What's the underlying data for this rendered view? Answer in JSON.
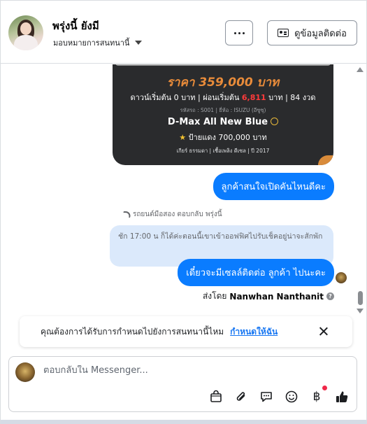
{
  "header": {
    "contact_name": "พรุ่งนี้ ยังมี",
    "assign_label": "มอบหมายการสนทนานี้",
    "more_label": "...",
    "info_button_label": "ดูข้อมูลติดต่อ"
  },
  "chat": {
    "card": {
      "price": "ราคา 359,000 บาท",
      "terms_prefix": "ดาวน์เริ่มต้น 0 บาท | ผ่อนเริ่มต้น ",
      "terms_installment": "6,811",
      "terms_suffix": " บาท | 84 งวด",
      "meta": "รหัสรถ : S001 | ยี่ห้อ : ISUZU (อีซูซุ)",
      "model": "D-Max All New Blue",
      "plate": "ป้ายแดง 700,000 บาท",
      "specs": "เกียร์ ธรรมดา  |  เชื้อเพลิง ดีเซล  |  ปี 2017"
    },
    "msg_customer_question": "ลูกค้าสนใจเปิดคันไหนดีคะ",
    "reply_note": "รถยนต์มือสอง ตอบกลับ พรุ่งนี้",
    "quoted_text": "ชัก 17:00 น ก็ได้ค่ะตอนนี้เขาเข้าออฟฟิศไปรับเช็คอยู่น่าจะสักพัก",
    "msg_reply": "เดี๋ยวจะมีเซลล์ติดต่อ ลูกค้า ไปนะคะ",
    "sent_by_label": "ส่งโดย",
    "sent_by_name": "Nanwhan Nanthanit",
    "help_glyph": "?"
  },
  "assign_prompt": {
    "text": "คุณต้องการได้รับการกำหนดไปยังการสนทนานี้ไหม",
    "link": "กำหนดให้ฉัน"
  },
  "composer": {
    "placeholder": "ตอบกลับใน Messenger...",
    "tools": [
      "shop-bag-icon",
      "paperclip-icon",
      "saved-reply-icon",
      "emoji-icon",
      "baht-icon",
      "thumbs-up-icon"
    ],
    "baht_symbol": "฿"
  },
  "colors": {
    "messenger_blue": "#0a7cff",
    "link_blue": "#1877f2",
    "quoted_bg": "#dbe9fb",
    "card_bg": "#2a2b2d",
    "price_orange": "#e88b3a"
  }
}
